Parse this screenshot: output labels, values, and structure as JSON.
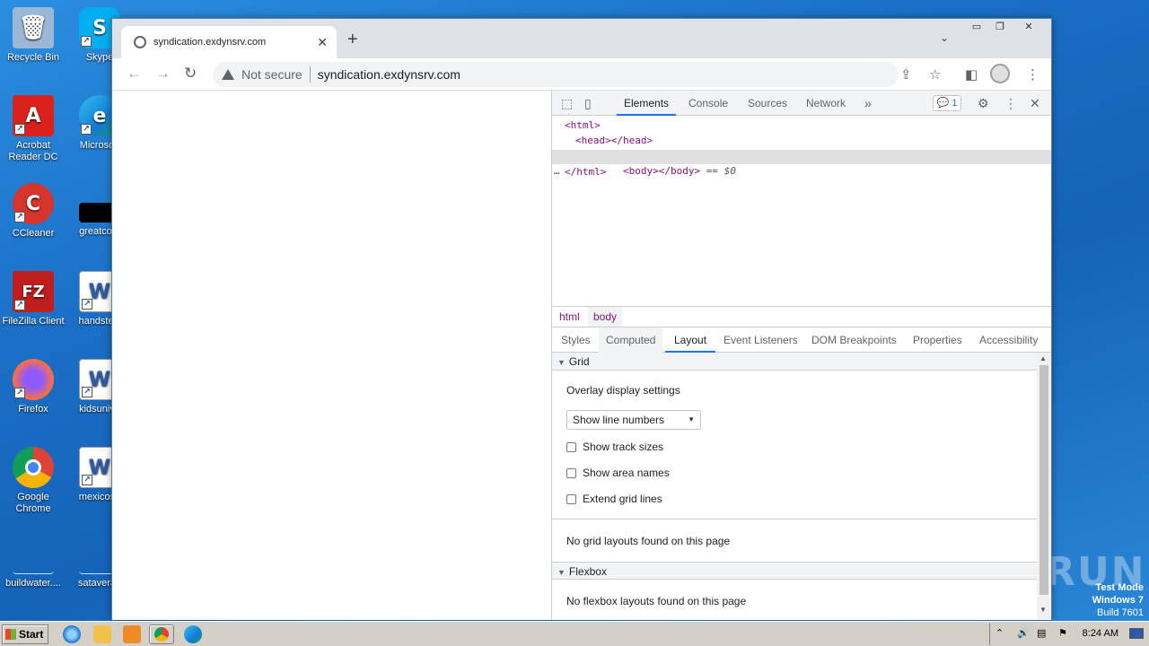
{
  "desktop": {
    "icons": [
      {
        "label": "Recycle Bin",
        "color": "#9ab7d6",
        "glyph": "🗑"
      },
      {
        "label": "Skype",
        "color": "#00aff0",
        "glyph": "S"
      },
      {
        "label": "Acrobat Reader DC",
        "color": "#d9221c",
        "glyph": "A"
      },
      {
        "label": "Microsoft",
        "color": "#0f7bd6",
        "glyph": "e"
      },
      {
        "label": "CCleaner",
        "color": "#d6352c",
        "glyph": "C"
      },
      {
        "label": "greatcom",
        "color": "#000000",
        "glyph": ""
      },
      {
        "label": "FileZilla Client",
        "color": "#bf1e1e",
        "glyph": "FZ"
      },
      {
        "label": "handstecl",
        "color": "#2a5aa8",
        "glyph": "W"
      },
      {
        "label": "Firefox",
        "color": "#ff7139",
        "glyph": "🦊"
      },
      {
        "label": "kidsunive",
        "color": "#2a5aa8",
        "glyph": "W"
      },
      {
        "label": "Google Chrome",
        "color": "#1a73e8",
        "glyph": "●"
      },
      {
        "label": "mexicose",
        "color": "#2a5aa8",
        "glyph": "W"
      },
      {
        "label": "buildwater....",
        "color": "#1c74c8",
        "glyph": ""
      },
      {
        "label": "sataverag",
        "color": "#1c74c8",
        "glyph": ""
      }
    ],
    "watermark": "ANY RUN",
    "testmode": {
      "line1": "Test Mode",
      "line2": "Windows 7",
      "line3": "Build 7601"
    }
  },
  "browser": {
    "tab_title": "syndication.exdynsrv.com",
    "tab_close": "✕",
    "new_tab": "+",
    "tab_dropdown": "⌄",
    "window_controls": [
      "▭",
      "❐",
      "✕"
    ],
    "nav": {
      "back": "←",
      "forward": "→",
      "reload": "↻"
    },
    "address": {
      "security": "Not secure",
      "url": "syndication.exdynsrv.com"
    },
    "icons": {
      "share": "⇪",
      "star": "☆",
      "sidepanel": "◧",
      "menu": "⋮"
    }
  },
  "devtools": {
    "tabs": [
      "Elements",
      "Console",
      "Sources",
      "Network"
    ],
    "more_tabs": "»",
    "badge": "1",
    "icons": {
      "inspect": "⬚",
      "device": "▯",
      "settings": "⚙",
      "kebab": "⋮",
      "close": "✕"
    },
    "dom": {
      "line1": "<html>",
      "line2": "<head></head>",
      "line3": "<body></body>",
      "line3_ref": " == $0",
      "line4": "</html>",
      "dots": "…"
    },
    "breadcrumbs": [
      "html",
      "body"
    ],
    "subtabs": [
      "Styles",
      "Computed",
      "Layout",
      "Event Listeners",
      "DOM Breakpoints",
      "Properties",
      "Accessibility"
    ],
    "layout": {
      "grid_title": "Grid",
      "overlay_label": "Overlay display settings",
      "select_value": "Show line numbers",
      "checkboxes": [
        "Show track sizes",
        "Show area names",
        "Extend grid lines"
      ],
      "no_grid": "No grid layouts found on this page",
      "flex_title": "Flexbox",
      "no_flex": "No flexbox layouts found on this page"
    }
  },
  "taskbar": {
    "start": "Start",
    "clock": "8:24 AM"
  }
}
